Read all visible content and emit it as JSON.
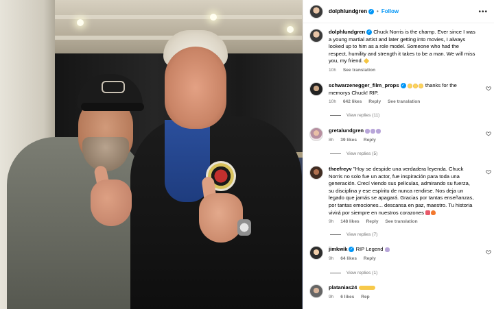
{
  "post": {
    "author": "dolphlundgren",
    "follow_label": "Follow",
    "dot": "•",
    "caption_user": "dolphlundgren",
    "caption": "Chuck Norris is the champ. Ever since I was a young martial artist and later getting into movies, I always looked up to him as a role model. Someone who had the respect, humility and strength it takes to be a man. We will miss you, my friend.",
    "caption_time": "10h",
    "see_translation": "See translation"
  },
  "comments": [
    {
      "user": "schwarzenegger_film_props",
      "text": "thanks for the memorys Chuck! RIP.",
      "time": "10h",
      "likes": "642 likes",
      "reply": "Reply",
      "translation": "See translation",
      "view_replies": "View replies (11)"
    },
    {
      "user": "gretalundgren",
      "text": "",
      "time": "8h",
      "likes": "39 likes",
      "reply": "Reply",
      "view_replies": "View replies (5)"
    },
    {
      "user": "theefreyv",
      "text": "\"Hoy se despide una verdadera leyenda. Chuck Norris no solo fue un actor, fue inspiración para toda una generación. Crecí viendo sus películas, admirando su fuerza, su disciplina y ese espíritu de nunca rendirse. Nos deja un legado que jamás se apagará. Gracias por tantas enseñanzas, por tantas emociones... descansa en paz, maestro. Tu historia vivirá por siempre en nuestros corazones",
      "time": "9h",
      "likes": "148 likes",
      "reply": "Reply",
      "translation": "See translation",
      "view_replies": "View replies (7)"
    },
    {
      "user": "jimkwik",
      "text": "RIP Legend",
      "time": "9h",
      "likes": "64 likes",
      "reply": "Reply",
      "view_replies": "View replies (1)"
    },
    {
      "user": "platanias24",
      "text": "",
      "time": "9h",
      "likes": "6 likes",
      "reply": "Rep"
    }
  ],
  "icons": {
    "verified": "verified-badge-icon",
    "more": "more-options-icon",
    "heart": "heart-icon"
  },
  "colors": {
    "accent": "#0095f6",
    "muted": "#737373"
  }
}
